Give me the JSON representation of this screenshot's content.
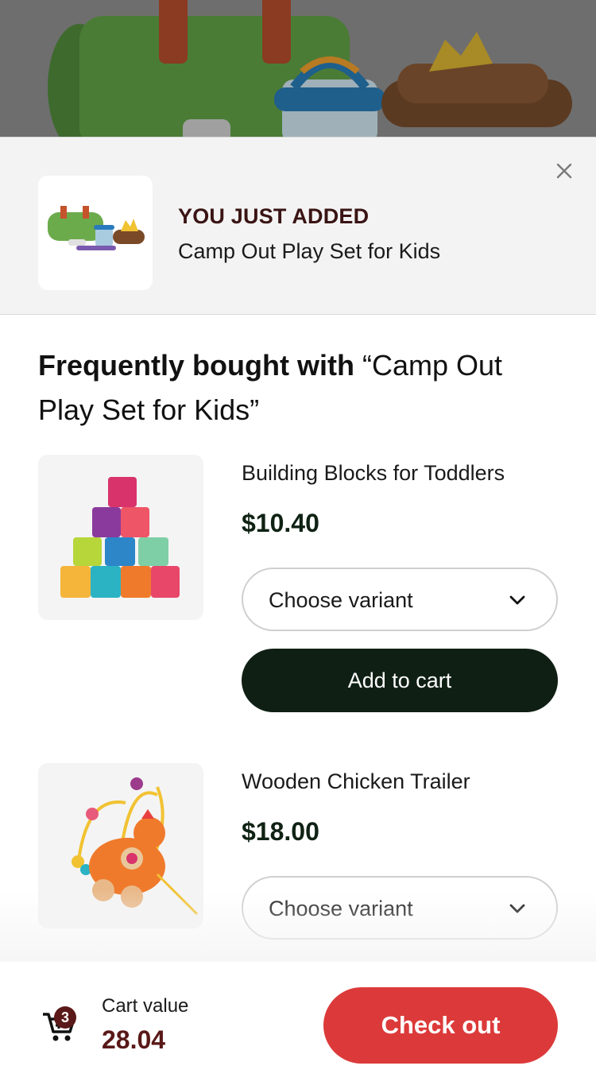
{
  "added": {
    "heading": "YOU JUST ADDED",
    "product_name": "Camp Out Play Set for Kids"
  },
  "frequently_bought": {
    "prefix": "Frequently bought with",
    "product_quote": "“Camp Out Play Set for Kids”"
  },
  "products": [
    {
      "name": "Building Blocks for Toddlers",
      "price": "$10.40",
      "variant_placeholder": "Choose variant",
      "add_label": "Add to cart"
    },
    {
      "name": "Wooden Chicken Trailer",
      "price": "$18.00",
      "variant_placeholder": "Choose variant"
    }
  ],
  "cart": {
    "count": "3",
    "label": "Cart value",
    "value": "28.04",
    "checkout_label": "Check out"
  },
  "colors": {
    "accent": "#dc3a3a",
    "dark_button": "#0f1f14",
    "brand_maroon": "#5a1818"
  },
  "icons": [
    "close-icon",
    "chevron-down-icon",
    "cart-icon"
  ]
}
